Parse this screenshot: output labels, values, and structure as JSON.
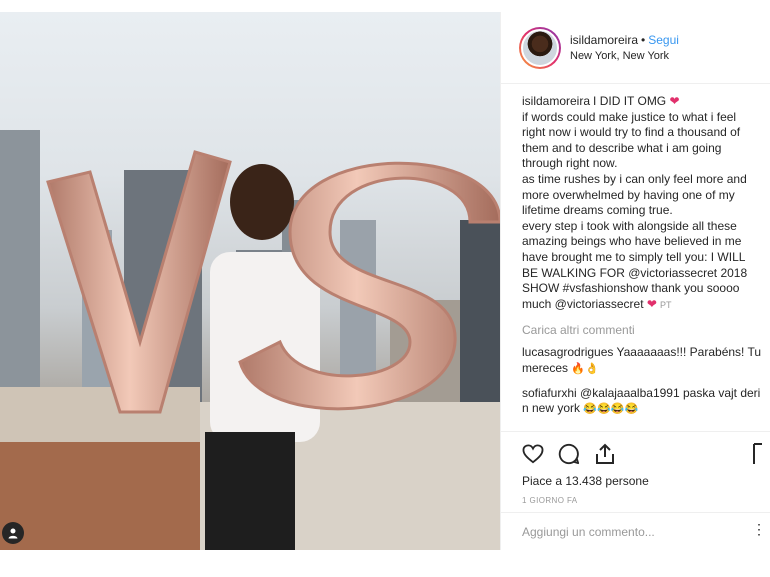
{
  "post": {
    "username": "isildamoreira",
    "follow_label": "Segui",
    "separator": "•",
    "location": "New York, New York"
  },
  "caption": {
    "username": "isildamoreira",
    "text": "I DID IT OMG",
    "heart": "❤",
    "lines": [
      "if words could make justice to what i feel right now i would try to find a thousand of them and to describe what i am going through right now.",
      "as time rushes by i can only feel more and more overwhelmed by having one of my lifetime dreams coming true.",
      "every step i took with alongside all these amazing beings who have believed in me have brought me to simply tell you: I WILL BE WALKING FOR @victoriassecret 2018 SHOW #vsfashionshow thank you soooo much @victoriassecret"
    ],
    "heart2": "❤",
    "pt": "PT"
  },
  "load_more": "Carica altri commenti",
  "comments": [
    {
      "username": "lucasagrodrigues",
      "text": "Yaaaaaaas!!! Parabéns! Tu mereces",
      "emoji": "🔥👌"
    },
    {
      "username": "sofiafurxhi",
      "text": "@kalajaaalba1991 paska vajt deri n new york",
      "emoji": "😂😂😂😂"
    }
  ],
  "actions": {
    "like_icon": "heart-outline-icon",
    "comment_icon": "comment-bubble-icon",
    "share_icon": "share-icon",
    "save_icon": "bookmark-icon"
  },
  "likes": "Piace a 13.438 persone",
  "timestamp": "1 GIORNO FA",
  "add_comment_placeholder": "Aggiungi un commento...",
  "more_icon": "⋮",
  "colors": {
    "link": "#3897f0",
    "balloon": "#d9a593",
    "text": "#262626",
    "muted": "#999999"
  }
}
